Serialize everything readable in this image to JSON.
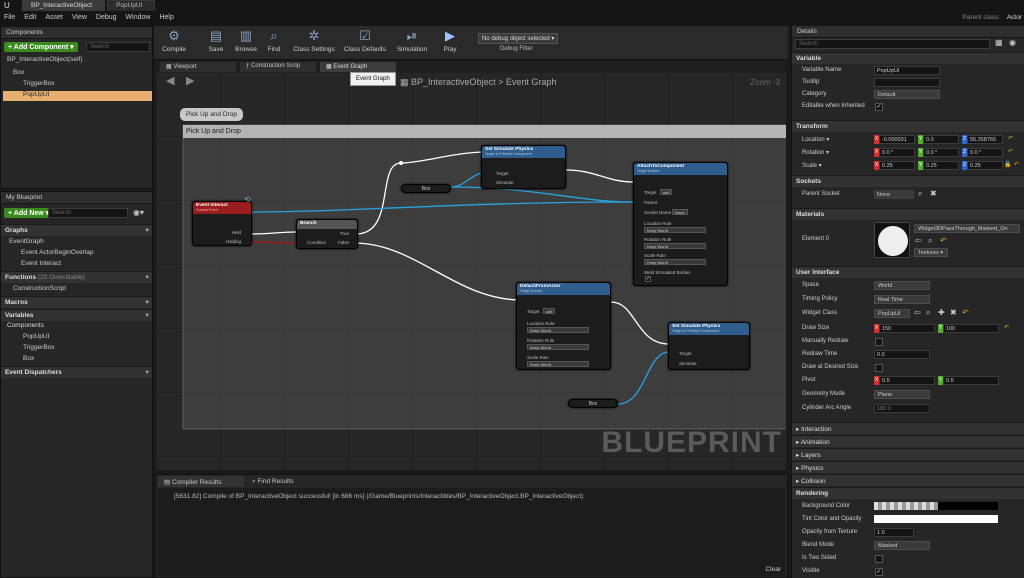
{
  "window": {
    "tabs": [
      "BP_InteractiveObject",
      "PopUpUI"
    ],
    "parent_class": "Parent class:",
    "actor": "Actor"
  },
  "menu": [
    "File",
    "Edit",
    "Asset",
    "View",
    "Debug",
    "Window",
    "Help"
  ],
  "components": {
    "title": "Components",
    "add": "+ Add Component ▾",
    "search": "Search",
    "items": [
      "BP_InteractiveObject(self)",
      "Box",
      "TriggerBox",
      "PopUpUI"
    ]
  },
  "myblueprint": {
    "title": "My Blueprint",
    "add": "+ Add New ▾",
    "search": "Search",
    "graphs": "Graphs",
    "eventgraph": "EventGraph",
    "events": [
      "Event ActorBeginOverlap",
      "Event Interact"
    ],
    "functions": "Functions",
    "functions_count": "(20 Overridable)",
    "function_items": [
      "ConstructionScript"
    ],
    "macros": "Macros",
    "variables": "Variables",
    "comp_header": "Components",
    "variable_items": [
      "PopUpUI",
      "TriggerBox",
      "Box"
    ],
    "dispatchers": "Event Dispatchers"
  },
  "toolbar": {
    "buttons": [
      "Compile",
      "Save",
      "Browse",
      "Find",
      "Class Settings",
      "Class Defaults",
      "Simulation",
      "Play"
    ],
    "debug_select": "No debug object selected ▾",
    "debug_filter": "Debug Filter"
  },
  "graph_tabs": [
    "Viewport",
    "Construction Scrip",
    "Event Graph"
  ],
  "tooltip": "Event Graph",
  "breadcrumb": {
    "root": "BP_InteractiveObject",
    "sep": ">",
    "current": "Event Graph",
    "zoom": "Zoom -3"
  },
  "comment": {
    "label": "Pick Up and Drop",
    "title": "Pick Up and Drop"
  },
  "watermark": "BLUEPRINT",
  "nodes": {
    "event_interact": {
      "title": "Event Interact",
      "sub": "Custom Event",
      "pins": [
        "Held",
        "Holding"
      ]
    },
    "branch": {
      "title": "Branch",
      "pins": [
        "True",
        "False",
        "Condition"
      ]
    },
    "set_sim1": {
      "title": "Set Simulate Physics",
      "sub": "Target is Primitive Component",
      "pins": [
        "Target",
        "Simulate"
      ]
    },
    "box1": "Box",
    "attach": {
      "title": "AttachToComponent",
      "sub": "Target is Actor",
      "pins": [
        "Target",
        "self",
        "Parent",
        "Socket Name",
        "None",
        "Location Rule",
        "Keep World",
        "Rotation Rule",
        "Keep World",
        "Scale Rule",
        "Keep World",
        "Weld Simulated Bodies"
      ]
    },
    "detach": {
      "title": "DetachFromActor",
      "sub": "Target is Actor",
      "pins": [
        "Target",
        "self",
        "Location Rule",
        "Keep World",
        "Rotation Rule",
        "Keep World",
        "Scale Rule",
        "Keep World"
      ]
    },
    "set_sim2": {
      "title": "Set Simulate Physics",
      "sub": "Target is Primitive Component",
      "pins": [
        "Target",
        "Simulate"
      ]
    },
    "box2": "Box"
  },
  "bottom": {
    "tabs": [
      "Compiler Results",
      "Find Results"
    ],
    "log": "[5631.82] Compile of BP_InteractiveObject successful! [in 686 ms] (/Game/Blueprints/Interactibles/BP_InteractiveObject.BP_InteractiveObject)",
    "clear": "Clear"
  },
  "details": {
    "title": "Details",
    "search": "Search",
    "variable": {
      "header": "Variable",
      "name_label": "Variable Name",
      "name": "PopUpUI",
      "tooltip_label": "Tooltip",
      "category_label": "Category",
      "category": "Default",
      "editable_label": "Editable when Inherited"
    },
    "transform": {
      "header": "Transform",
      "location_label": "Location ▾",
      "location": [
        "-0.000031",
        "0.0",
        "55.358765"
      ],
      "rotation_label": "Rotation ▾",
      "rotation": [
        "0.0 °",
        "0.0 °",
        "0.0 °"
      ],
      "scale_label": "Scale ▾",
      "scale": [
        "0.25",
        "0.25",
        "0.25"
      ]
    },
    "sockets": {
      "header": "Sockets",
      "parent_label": "Parent Socket",
      "parent": "None"
    },
    "materials": {
      "header": "Materials",
      "element_label": "Element 0",
      "material": "Widget3DPassThrough_Masked_On",
      "textures": "Textures ▾"
    },
    "ui": {
      "header": "User Interface",
      "space_label": "Space",
      "space": "World",
      "timing_label": "Timing Policy",
      "timing": "Real Time",
      "widget_label": "Widget Class",
      "widget": "PopUpUI",
      "draw_label": "Draw Size",
      "draw": [
        "150",
        "100"
      ],
      "manual_label": "Manually Redraw",
      "redraw_label": "Redraw Time",
      "redraw": "0.0",
      "desired_label": "Draw at Desired Size",
      "pivot_label": "Pivot",
      "pivot": [
        "0.5",
        "0.5"
      ],
      "geometry_label": "Geometry Mode",
      "geometry": "Plane",
      "arc_label": "Cylinder Arc Angle",
      "arc": "180.0"
    },
    "collapsed": [
      "Interaction",
      "Animation",
      "Layers",
      "Physics",
      "Collision"
    ],
    "rendering": {
      "header": "Rendering",
      "bg_label": "Background Color",
      "tint_label": "Tint Color and Opacity",
      "opacity_label": "Opacity from Texture",
      "opacity": "1.0",
      "blend_label": "Blend Mode",
      "blend": "Masked",
      "twosided_label": "Is Two Sided",
      "visible_label": "Visible"
    }
  }
}
